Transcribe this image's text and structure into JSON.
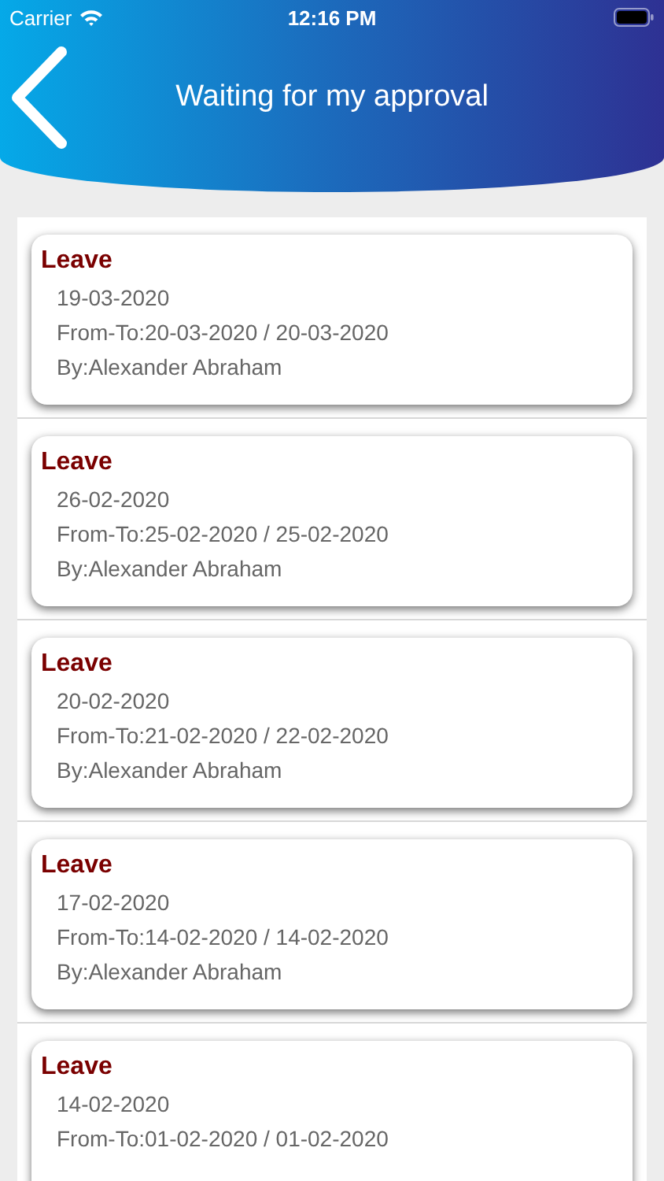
{
  "status_bar": {
    "carrier": "Carrier",
    "time": "12:16 PM"
  },
  "header": {
    "title": "Waiting for my approval"
  },
  "requests": [
    {
      "type": "Leave",
      "date": "19-03-2020",
      "range": "From-To:20-03-2020 / 20-03-2020",
      "by": "By:Alexander Abraham"
    },
    {
      "type": "Leave",
      "date": "26-02-2020",
      "range": "From-To:25-02-2020 / 25-02-2020",
      "by": "By:Alexander Abraham"
    },
    {
      "type": "Leave",
      "date": "20-02-2020",
      "range": "From-To:21-02-2020 / 22-02-2020",
      "by": "By:Alexander Abraham"
    },
    {
      "type": "Leave",
      "date": "17-02-2020",
      "range": "From-To:14-02-2020 / 14-02-2020",
      "by": "By:Alexander Abraham"
    },
    {
      "type": "Leave",
      "date": "14-02-2020",
      "range": "From-To:01-02-2020 / 01-02-2020"
    }
  ]
}
